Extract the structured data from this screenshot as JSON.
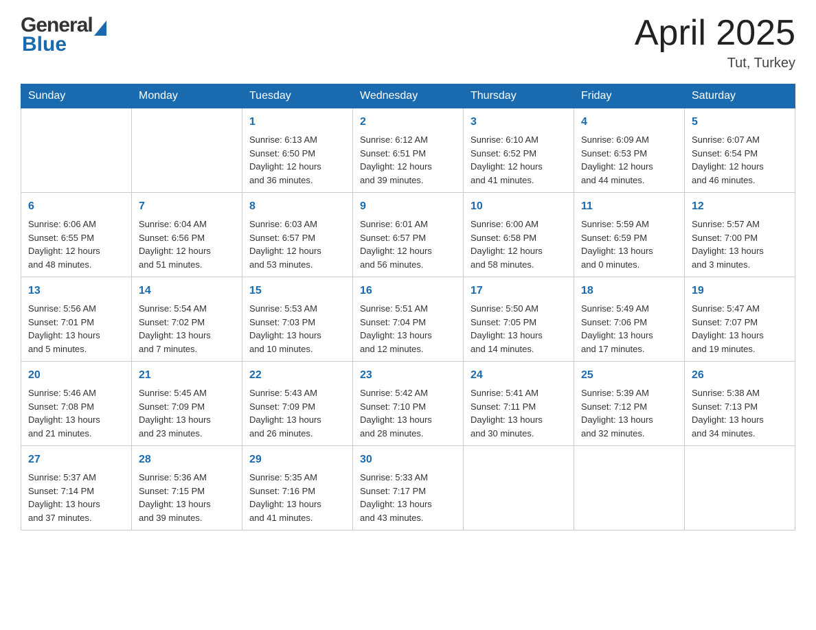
{
  "header": {
    "logo_general": "General",
    "logo_blue": "Blue",
    "title": "April 2025",
    "location": "Tut, Turkey"
  },
  "weekdays": [
    "Sunday",
    "Monday",
    "Tuesday",
    "Wednesday",
    "Thursday",
    "Friday",
    "Saturday"
  ],
  "weeks": [
    [
      {
        "day": "",
        "info": ""
      },
      {
        "day": "",
        "info": ""
      },
      {
        "day": "1",
        "info": "Sunrise: 6:13 AM\nSunset: 6:50 PM\nDaylight: 12 hours\nand 36 minutes."
      },
      {
        "day": "2",
        "info": "Sunrise: 6:12 AM\nSunset: 6:51 PM\nDaylight: 12 hours\nand 39 minutes."
      },
      {
        "day": "3",
        "info": "Sunrise: 6:10 AM\nSunset: 6:52 PM\nDaylight: 12 hours\nand 41 minutes."
      },
      {
        "day": "4",
        "info": "Sunrise: 6:09 AM\nSunset: 6:53 PM\nDaylight: 12 hours\nand 44 minutes."
      },
      {
        "day": "5",
        "info": "Sunrise: 6:07 AM\nSunset: 6:54 PM\nDaylight: 12 hours\nand 46 minutes."
      }
    ],
    [
      {
        "day": "6",
        "info": "Sunrise: 6:06 AM\nSunset: 6:55 PM\nDaylight: 12 hours\nand 48 minutes."
      },
      {
        "day": "7",
        "info": "Sunrise: 6:04 AM\nSunset: 6:56 PM\nDaylight: 12 hours\nand 51 minutes."
      },
      {
        "day": "8",
        "info": "Sunrise: 6:03 AM\nSunset: 6:57 PM\nDaylight: 12 hours\nand 53 minutes."
      },
      {
        "day": "9",
        "info": "Sunrise: 6:01 AM\nSunset: 6:57 PM\nDaylight: 12 hours\nand 56 minutes."
      },
      {
        "day": "10",
        "info": "Sunrise: 6:00 AM\nSunset: 6:58 PM\nDaylight: 12 hours\nand 58 minutes."
      },
      {
        "day": "11",
        "info": "Sunrise: 5:59 AM\nSunset: 6:59 PM\nDaylight: 13 hours\nand 0 minutes."
      },
      {
        "day": "12",
        "info": "Sunrise: 5:57 AM\nSunset: 7:00 PM\nDaylight: 13 hours\nand 3 minutes."
      }
    ],
    [
      {
        "day": "13",
        "info": "Sunrise: 5:56 AM\nSunset: 7:01 PM\nDaylight: 13 hours\nand 5 minutes."
      },
      {
        "day": "14",
        "info": "Sunrise: 5:54 AM\nSunset: 7:02 PM\nDaylight: 13 hours\nand 7 minutes."
      },
      {
        "day": "15",
        "info": "Sunrise: 5:53 AM\nSunset: 7:03 PM\nDaylight: 13 hours\nand 10 minutes."
      },
      {
        "day": "16",
        "info": "Sunrise: 5:51 AM\nSunset: 7:04 PM\nDaylight: 13 hours\nand 12 minutes."
      },
      {
        "day": "17",
        "info": "Sunrise: 5:50 AM\nSunset: 7:05 PM\nDaylight: 13 hours\nand 14 minutes."
      },
      {
        "day": "18",
        "info": "Sunrise: 5:49 AM\nSunset: 7:06 PM\nDaylight: 13 hours\nand 17 minutes."
      },
      {
        "day": "19",
        "info": "Sunrise: 5:47 AM\nSunset: 7:07 PM\nDaylight: 13 hours\nand 19 minutes."
      }
    ],
    [
      {
        "day": "20",
        "info": "Sunrise: 5:46 AM\nSunset: 7:08 PM\nDaylight: 13 hours\nand 21 minutes."
      },
      {
        "day": "21",
        "info": "Sunrise: 5:45 AM\nSunset: 7:09 PM\nDaylight: 13 hours\nand 23 minutes."
      },
      {
        "day": "22",
        "info": "Sunrise: 5:43 AM\nSunset: 7:09 PM\nDaylight: 13 hours\nand 26 minutes."
      },
      {
        "day": "23",
        "info": "Sunrise: 5:42 AM\nSunset: 7:10 PM\nDaylight: 13 hours\nand 28 minutes."
      },
      {
        "day": "24",
        "info": "Sunrise: 5:41 AM\nSunset: 7:11 PM\nDaylight: 13 hours\nand 30 minutes."
      },
      {
        "day": "25",
        "info": "Sunrise: 5:39 AM\nSunset: 7:12 PM\nDaylight: 13 hours\nand 32 minutes."
      },
      {
        "day": "26",
        "info": "Sunrise: 5:38 AM\nSunset: 7:13 PM\nDaylight: 13 hours\nand 34 minutes."
      }
    ],
    [
      {
        "day": "27",
        "info": "Sunrise: 5:37 AM\nSunset: 7:14 PM\nDaylight: 13 hours\nand 37 minutes."
      },
      {
        "day": "28",
        "info": "Sunrise: 5:36 AM\nSunset: 7:15 PM\nDaylight: 13 hours\nand 39 minutes."
      },
      {
        "day": "29",
        "info": "Sunrise: 5:35 AM\nSunset: 7:16 PM\nDaylight: 13 hours\nand 41 minutes."
      },
      {
        "day": "30",
        "info": "Sunrise: 5:33 AM\nSunset: 7:17 PM\nDaylight: 13 hours\nand 43 minutes."
      },
      {
        "day": "",
        "info": ""
      },
      {
        "day": "",
        "info": ""
      },
      {
        "day": "",
        "info": ""
      }
    ]
  ]
}
